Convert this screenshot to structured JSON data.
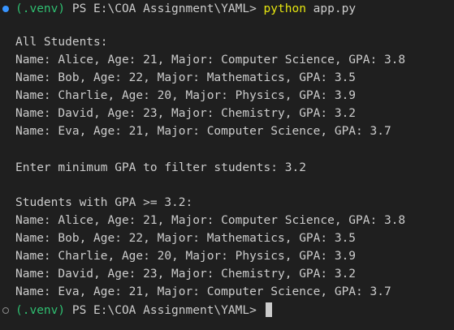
{
  "colors": {
    "background": "#1f1f1f",
    "text": "#cccccc",
    "venv": "#2fbf71",
    "command_python": "#e5e510",
    "marker_success": "#3794ff",
    "marker_idle": "#8b8b8b"
  },
  "prompt1": {
    "venv": "(.venv)",
    "path": " PS E:\\COA Assignment\\YAML> ",
    "command": "python",
    "args": " app.py"
  },
  "output": [
    "All Students:",
    "Name: Alice, Age: 21, Major: Computer Science, GPA: 3.8",
    "Name: Bob, Age: 22, Major: Mathematics, GPA: 3.5",
    "Name: Charlie, Age: 20, Major: Physics, GPA: 3.9",
    "Name: David, Age: 23, Major: Chemistry, GPA: 3.2",
    "Name: Eva, Age: 21, Major: Computer Science, GPA: 3.7",
    "Enter minimum GPA to filter students: 3.2",
    "Students with GPA >= 3.2:",
    "Name: Alice, Age: 21, Major: Computer Science, GPA: 3.8",
    "Name: Bob, Age: 22, Major: Mathematics, GPA: 3.5",
    "Name: Charlie, Age: 20, Major: Physics, GPA: 3.9",
    "Name: David, Age: 23, Major: Chemistry, GPA: 3.2",
    "Name: Eva, Age: 21, Major: Computer Science, GPA: 3.7"
  ],
  "prompt2": {
    "venv": "(.venv)",
    "path": " PS E:\\COA Assignment\\YAML> "
  }
}
